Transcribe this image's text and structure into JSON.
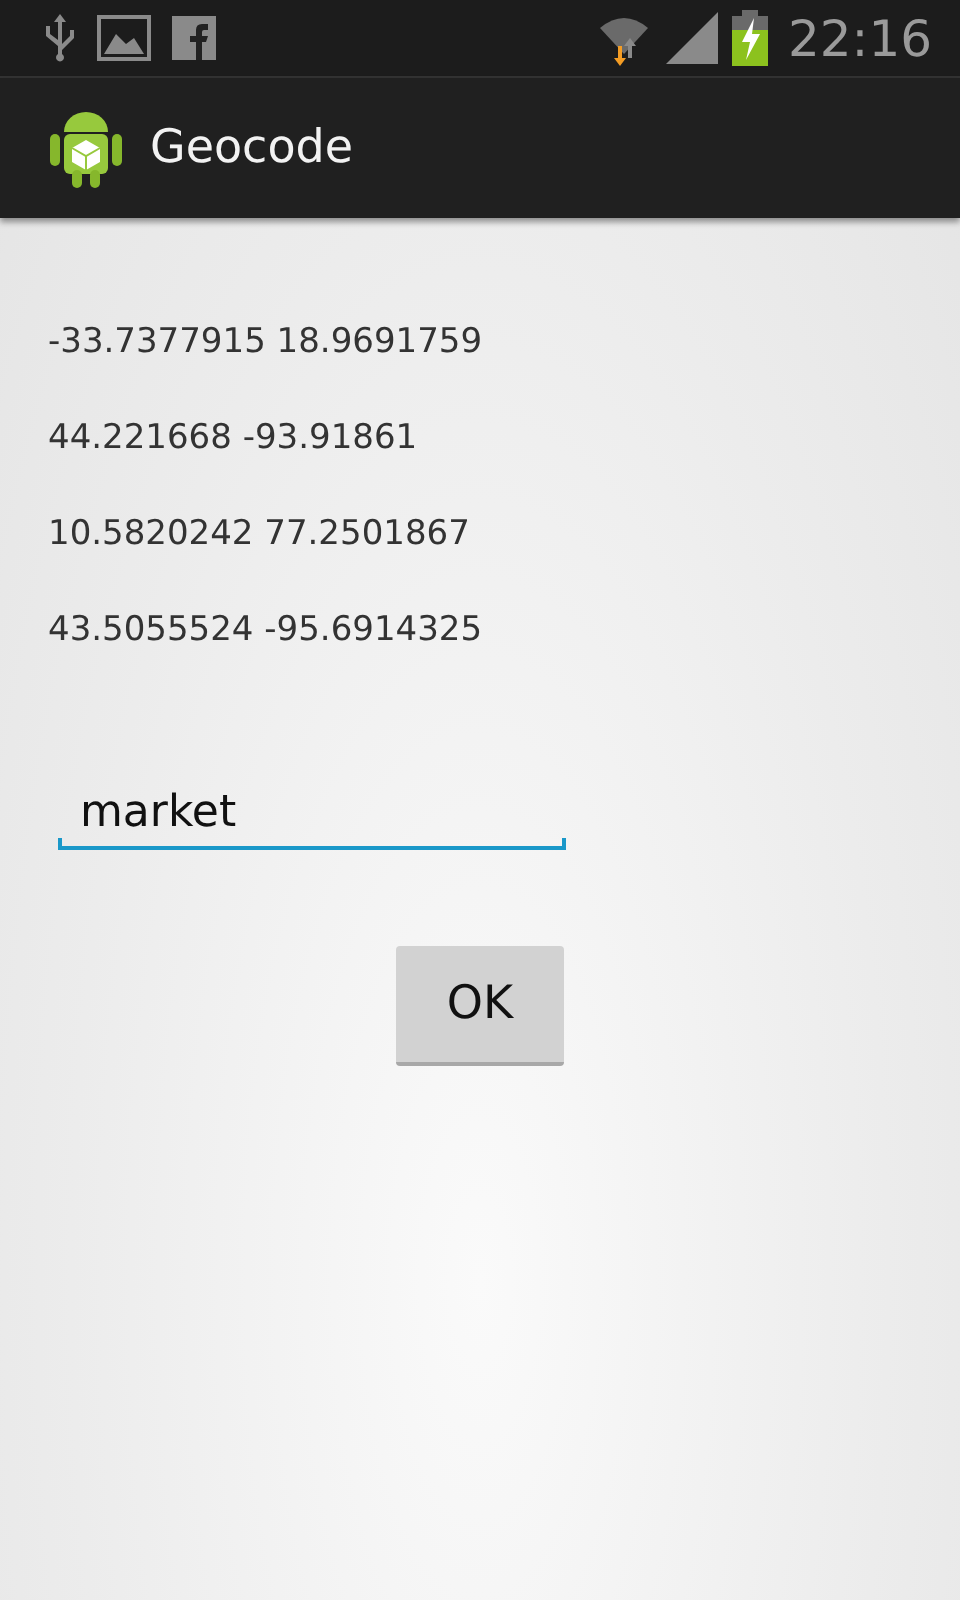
{
  "status_bar": {
    "time": "22:16"
  },
  "action_bar": {
    "title": "Geocode"
  },
  "results": [
    "-33.7377915 18.9691759",
    "44.221668 -93.91861",
    "10.5820242 77.2501867",
    "43.5055524 -95.6914325"
  ],
  "search": {
    "value": "market"
  },
  "buttons": [
    "OK"
  ]
}
